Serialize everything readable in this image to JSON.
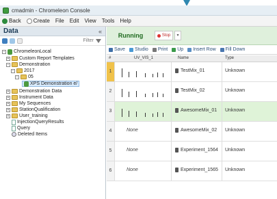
{
  "window": {
    "title": "cmadmin - Chromeleon Console"
  },
  "menu": {
    "items": [
      "Back",
      "Create",
      "File",
      "Edit",
      "View",
      "Tools",
      "Help"
    ]
  },
  "left_panel": {
    "title": "Data",
    "filter_label": "Filter",
    "tree": [
      {
        "label": "ChromeleonLocal",
        "indent": 0
      },
      {
        "label": "Custom Report Templates",
        "indent": 1
      },
      {
        "label": "Demonstration",
        "indent": 1
      },
      {
        "label": "2017",
        "indent": 2
      },
      {
        "label": "05",
        "indent": 3
      },
      {
        "label": "XPS Demonstration e/",
        "indent": 4
      },
      {
        "label": "Demonstration Data",
        "indent": 1
      },
      {
        "label": "Instrument Data",
        "indent": 1
      },
      {
        "label": "My Sequences",
        "indent": 1
      },
      {
        "label": "StationQualification",
        "indent": 1
      },
      {
        "label": "User_training",
        "indent": 1
      },
      {
        "label": "InjectionQueryResults",
        "indent": 1
      },
      {
        "label": "Query",
        "indent": 1
      },
      {
        "label": "Deleted Items",
        "indent": 1
      }
    ]
  },
  "status": {
    "state": "Running",
    "stop_label": "Stop"
  },
  "actions": [
    "Save",
    "Studio",
    "Print",
    "Up",
    "Insert Row",
    "Fill Down"
  ],
  "grid": {
    "headers": [
      "#",
      "UV_VIS_1",
      "Name",
      "Type"
    ],
    "rows": [
      {
        "num": "1",
        "uv": "chromatogram",
        "name": "TestMix_01",
        "type": "Unknown"
      },
      {
        "num": "2",
        "uv": "chromatogram",
        "name": "TestMix_02",
        "type": "Unknown"
      },
      {
        "num": "3",
        "uv": "chromatogram",
        "name": "AwesomeMix_01",
        "type": "Unknown"
      },
      {
        "num": "4",
        "uv": "None",
        "name": "AwesomeMix_02",
        "type": "Unknown"
      },
      {
        "num": "5",
        "uv": "None",
        "name": "Experiment_1564",
        "type": "Unknown"
      },
      {
        "num": "6",
        "uv": "None",
        "name": "Experiment_1565",
        "type": "Unknown"
      }
    ]
  }
}
